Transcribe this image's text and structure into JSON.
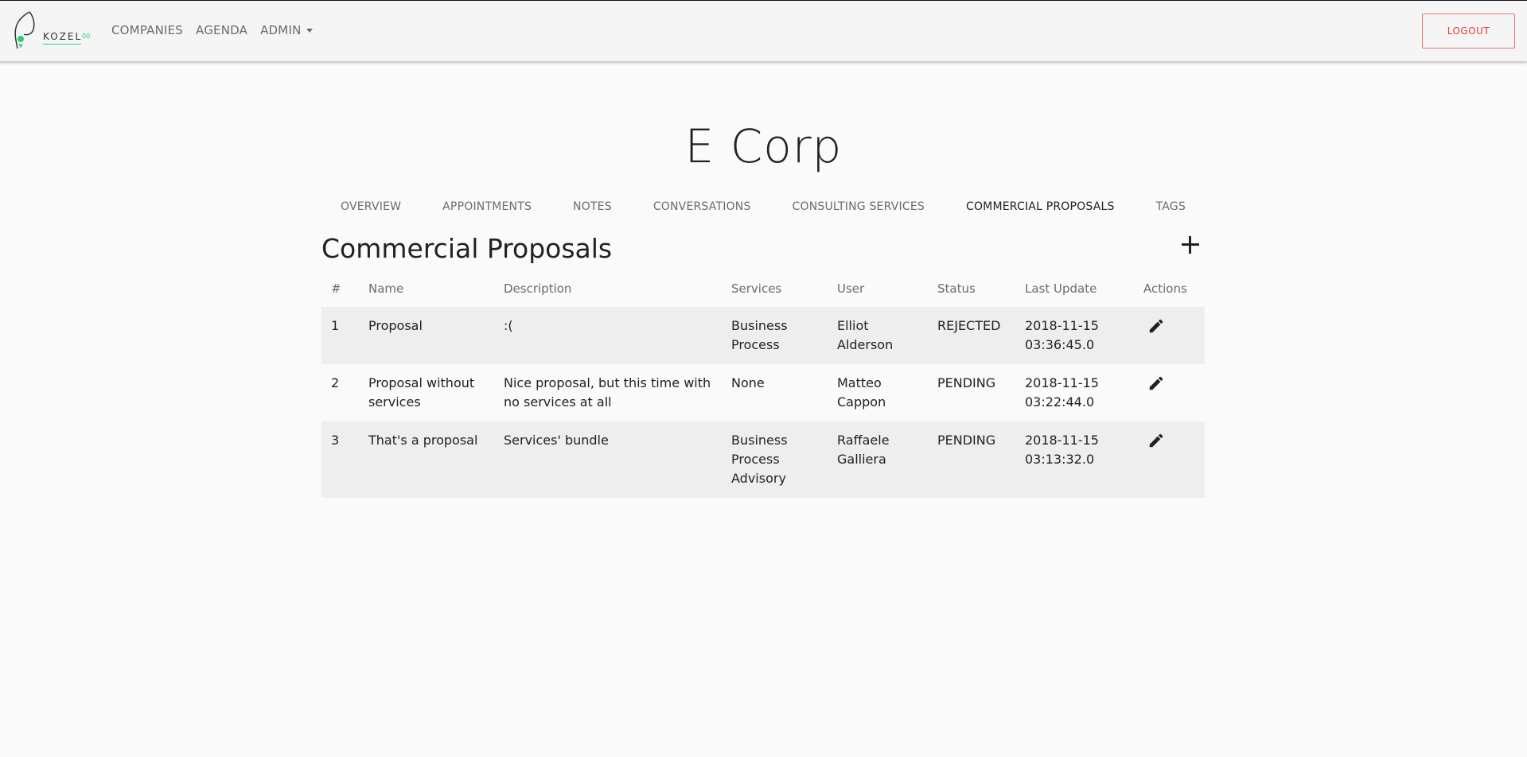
{
  "navbar": {
    "logo_text": "KOZEL",
    "logo_suffix": "00",
    "links": [
      "COMPANIES",
      "AGENDA",
      "ADMIN"
    ],
    "logout": "LOGOUT"
  },
  "company": {
    "name": "E Corp"
  },
  "tabs": [
    {
      "label": "OVERVIEW"
    },
    {
      "label": "APPOINTMENTS"
    },
    {
      "label": "NOTES"
    },
    {
      "label": "CONVERSATIONS"
    },
    {
      "label": "CONSULTING SERVICES"
    },
    {
      "label": "COMMERCIAL PROPOSALS"
    },
    {
      "label": "TAGS"
    }
  ],
  "active_tab": "COMMERCIAL PROPOSALS",
  "section": {
    "title": "Commercial Proposals"
  },
  "table": {
    "columns": [
      "#",
      "Name",
      "Description",
      "Services",
      "User",
      "Status",
      "Last Update",
      "Actions"
    ],
    "rows": [
      {
        "num": "1",
        "name": "Proposal",
        "description": ":(",
        "services": [
          "Business Process"
        ],
        "user": [
          "Elliot Alderson"
        ],
        "status": "REJECTED",
        "updated": [
          "2018-11-15",
          "03:36:45.0"
        ]
      },
      {
        "num": "2",
        "name": "Proposal without services",
        "description": "Nice proposal, but this time with no services at all",
        "services": [
          "None"
        ],
        "user": [
          "Matteo Cappon"
        ],
        "status": "PENDING",
        "updated": [
          "2018-11-15",
          "03:22:44.0"
        ]
      },
      {
        "num": "3",
        "name": "That's a proposal",
        "description": "Services' bundle",
        "services": [
          "Business Process",
          "Advisory"
        ],
        "user": [
          "Raffaele Galliera"
        ],
        "status": "PENDING",
        "updated": [
          "2018-11-15",
          "03:13:32.0"
        ]
      }
    ]
  },
  "icons": {
    "edit": "pencil-icon",
    "add": "plus-icon",
    "logo": "elephant-logo"
  },
  "colors": {
    "logout": "#e53935",
    "logo_accent": "#2ecc71"
  }
}
